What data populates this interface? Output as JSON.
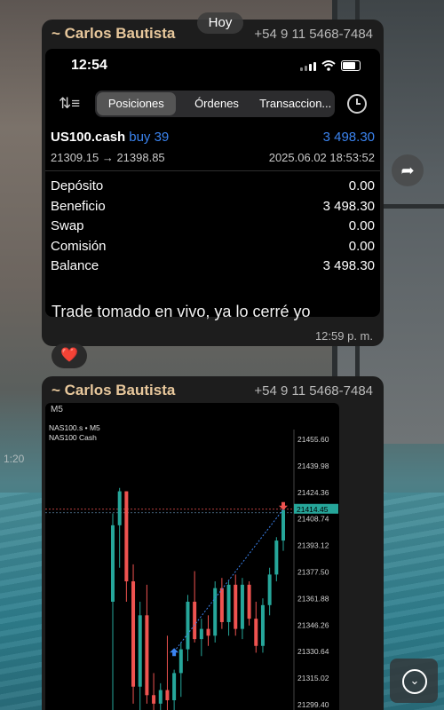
{
  "day_label": "Hoy",
  "message1": {
    "sender": "~ Carlos Bautista",
    "phone": "+54 9 11 5468-7484",
    "screenshot": {
      "status_time": "12:54",
      "tabs": [
        {
          "label": "Posiciones",
          "active": true
        },
        {
          "label": "Órdenes",
          "active": false
        },
        {
          "label": "Transaccion...",
          "active": false
        }
      ],
      "position": {
        "symbol": "US100.cash",
        "side": "buy 39",
        "profit": "3 498.30",
        "prices": "21309.15 → 21398.85",
        "datetime": "2025.06.02 18:53:52"
      },
      "summary": [
        {
          "label": "Depósito",
          "value": "0.00"
        },
        {
          "label": "Beneficio",
          "value": "3 498.30"
        },
        {
          "label": "Swap",
          "value": "0.00"
        },
        {
          "label": "Comisión",
          "value": "0.00"
        },
        {
          "label": "Balance",
          "value": "3 498.30"
        }
      ]
    },
    "caption": "Trade tomado en vivo, ya lo cerré yo",
    "time": "12:59 p. m.",
    "reaction": "❤️"
  },
  "message2": {
    "sender": "~ Carlos Bautista",
    "phone": "+54 9 11 5468-7484",
    "chart": {
      "toolbar_label": "M5",
      "symbol_line": "NAS100.s • M5",
      "name_line": "NAS100 Cash",
      "current_price": "21414.45"
    }
  },
  "colors": {
    "accent_blue": "#3b84f0",
    "bull": "#26a69a",
    "bear": "#ef5350",
    "sender": "#e8c89c"
  },
  "chart_data": {
    "type": "candlestick",
    "title": "NAS100.s • M5",
    "subtitle": "NAS100 Cash",
    "y_ticks": [
      21455.6,
      21439.98,
      21424.36,
      21408.74,
      21393.12,
      21377.5,
      21361.88,
      21346.26,
      21330.64,
      21315.02,
      21299.4
    ],
    "ylim": [
      21299.4,
      21455.6
    ],
    "current_price": 21414.45,
    "candles": [
      {
        "o": 21360,
        "h": 21412,
        "l": 21296,
        "c": 21405
      },
      {
        "o": 21405,
        "h": 21427,
        "l": 21380,
        "c": 21425
      },
      {
        "o": 21425,
        "h": 21425,
        "l": 21360,
        "c": 21372
      },
      {
        "o": 21372,
        "h": 21382,
        "l": 21300,
        "c": 21310
      },
      {
        "o": 21310,
        "h": 21360,
        "l": 21296,
        "c": 21352
      },
      {
        "o": 21352,
        "h": 21370,
        "l": 21300,
        "c": 21305
      },
      {
        "o": 21305,
        "h": 21318,
        "l": 21296,
        "c": 21300
      },
      {
        "o": 21300,
        "h": 21312,
        "l": 21296,
        "c": 21308
      },
      {
        "o": 21308,
        "h": 21340,
        "l": 21296,
        "c": 21302
      },
      {
        "o": 21302,
        "h": 21320,
        "l": 21296,
        "c": 21318
      },
      {
        "o": 21318,
        "h": 21336,
        "l": 21304,
        "c": 21332
      },
      {
        "o": 21332,
        "h": 21364,
        "l": 21325,
        "c": 21360
      },
      {
        "o": 21360,
        "h": 21378,
        "l": 21336,
        "c": 21338
      },
      {
        "o": 21338,
        "h": 21350,
        "l": 21328,
        "c": 21344
      },
      {
        "o": 21344,
        "h": 21352,
        "l": 21334,
        "c": 21340
      },
      {
        "o": 21340,
        "h": 21372,
        "l": 21336,
        "c": 21368
      },
      {
        "o": 21368,
        "h": 21374,
        "l": 21344,
        "c": 21348
      },
      {
        "o": 21348,
        "h": 21372,
        "l": 21340,
        "c": 21370
      },
      {
        "o": 21370,
        "h": 21376,
        "l": 21340,
        "c": 21344
      },
      {
        "o": 21344,
        "h": 21374,
        "l": 21338,
        "c": 21370
      },
      {
        "o": 21370,
        "h": 21372,
        "l": 21346,
        "c": 21350
      },
      {
        "o": 21350,
        "h": 21360,
        "l": 21330,
        "c": 21334
      },
      {
        "o": 21334,
        "h": 21362,
        "l": 21330,
        "c": 21358
      },
      {
        "o": 21358,
        "h": 21380,
        "l": 21352,
        "c": 21376
      },
      {
        "o": 21376,
        "h": 21398,
        "l": 21372,
        "c": 21396
      },
      {
        "o": 21396,
        "h": 21416,
        "l": 21390,
        "c": 21414
      }
    ],
    "trade": {
      "entry_index": 9,
      "entry_price": 21330.64,
      "exit_index": 25,
      "exit_price": 21414.45
    }
  }
}
